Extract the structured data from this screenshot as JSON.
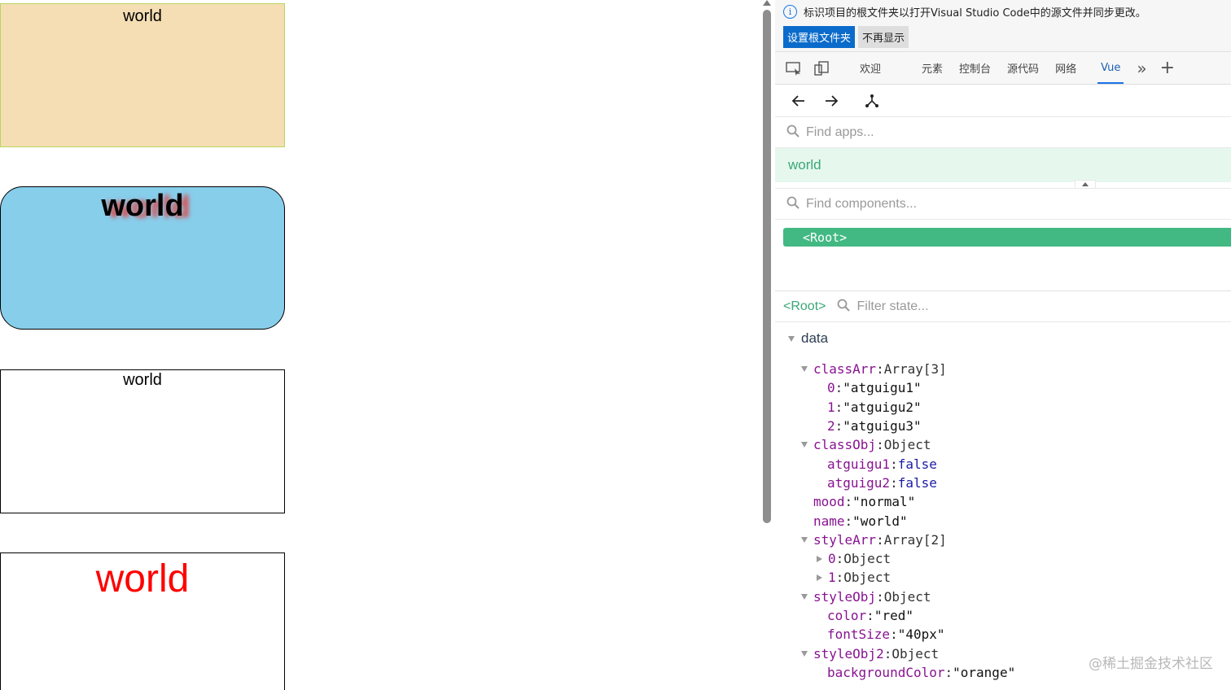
{
  "preview": {
    "box1_text": "world",
    "box2_text": "world",
    "box3_text": "world",
    "box4_text": "world"
  },
  "infobar": {
    "message": "标识项目的根文件夹以打开Visual Studio Code中的源文件并同步更改。",
    "set_root_label": "设置根文件夹",
    "dont_show_label": "不再显示"
  },
  "tabs": {
    "welcome": "欢迎",
    "elements": "元素",
    "console": "控制台",
    "sources": "源代码",
    "network": "网络",
    "vue": "Vue"
  },
  "apps": {
    "search_placeholder": "Find apps...",
    "selected_app": "world"
  },
  "components": {
    "search_placeholder": "Find components...",
    "root_node": "<Root>"
  },
  "state": {
    "root_label": "<Root>",
    "filter_placeholder": "Filter state...",
    "section": "data",
    "rows": [
      {
        "key": "classArr",
        "sep": ": ",
        "value": "Array[3]"
      },
      {
        "key": "0",
        "sep": ": ",
        "value": "\"atguigu1\""
      },
      {
        "key": "1",
        "sep": ": ",
        "value": "\"atguigu2\""
      },
      {
        "key": "2",
        "sep": ": ",
        "value": "\"atguigu3\""
      },
      {
        "key": "classObj",
        "sep": ": ",
        "value": "Object"
      },
      {
        "key": "atguigu1",
        "sep": ": ",
        "value": "false"
      },
      {
        "key": "atguigu2",
        "sep": ": ",
        "value": "false"
      },
      {
        "key": "mood",
        "sep": ": ",
        "value": "\"normal\""
      },
      {
        "key": "name",
        "sep": ": ",
        "value": "\"world\""
      },
      {
        "key": "styleArr",
        "sep": ": ",
        "value": "Array[2]"
      },
      {
        "key": "0",
        "sep": ": ",
        "value": "Object"
      },
      {
        "key": "1",
        "sep": ": ",
        "value": "Object"
      },
      {
        "key": "styleObj",
        "sep": ": ",
        "value": "Object"
      },
      {
        "key": "color",
        "sep": ": ",
        "value": "\"red\""
      },
      {
        "key": "fontSize",
        "sep": ": ",
        "value": "\"40px\""
      },
      {
        "key": "styleObj2",
        "sep": ": ",
        "value": "Object"
      },
      {
        "key": "backgroundColor",
        "sep": ": ",
        "value": "\"orange\""
      }
    ]
  },
  "watermark": "@稀土掘金技术社区",
  "colors": {
    "vue_green": "#42b983",
    "accent_blue": "#1a73e8",
    "box1_bg": "#f5deb3",
    "box2_bg": "#87ceeb",
    "box4_text": "#ff0000"
  }
}
